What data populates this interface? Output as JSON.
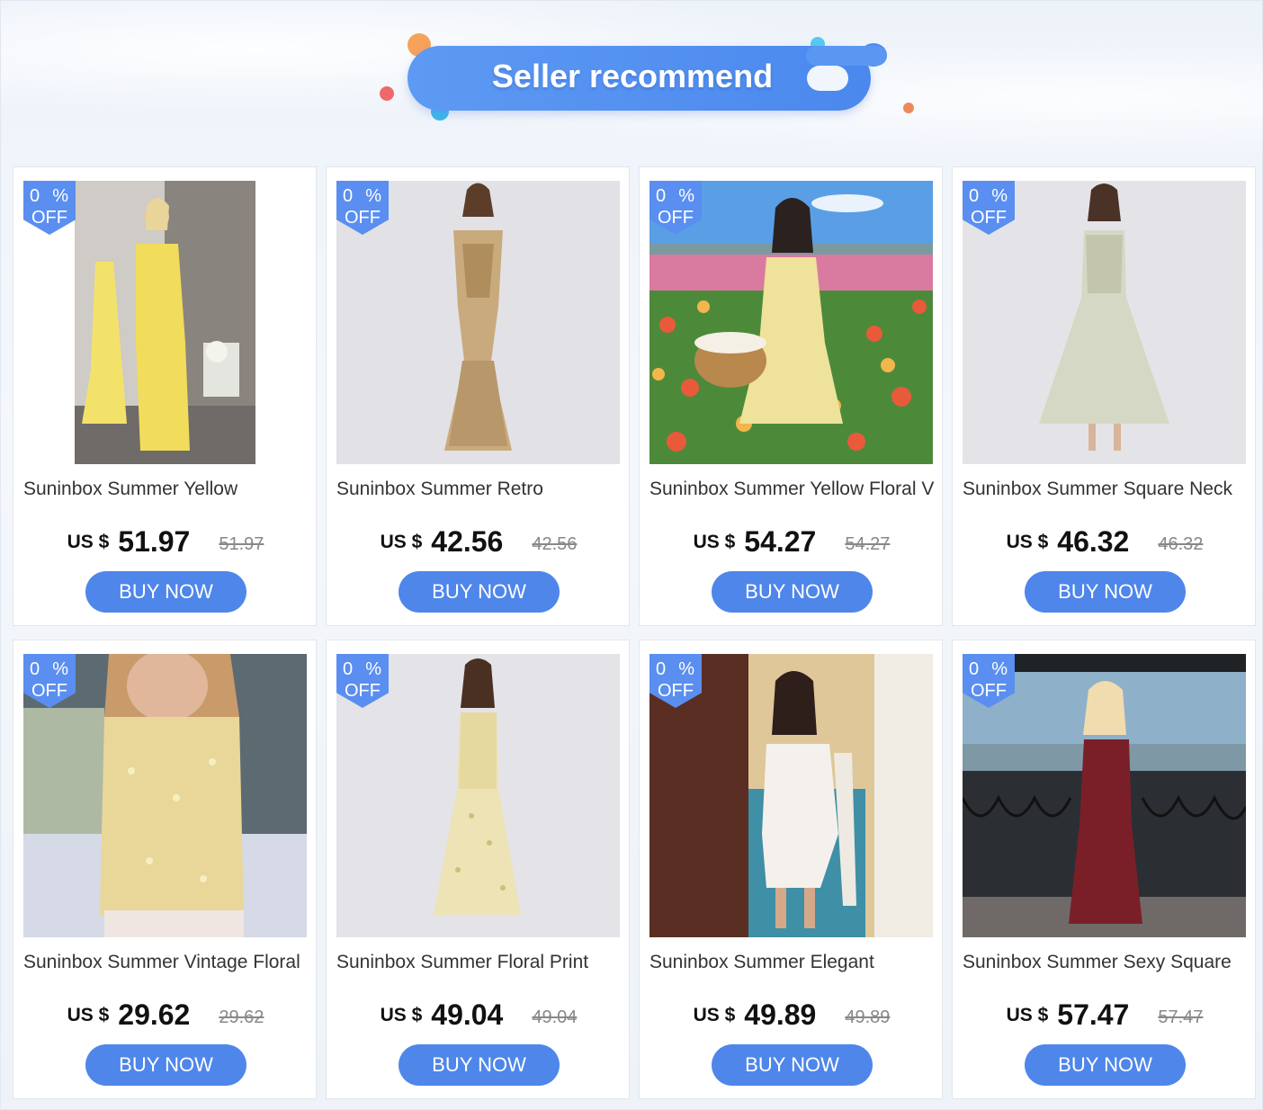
{
  "header": {
    "title": "Seller recommend",
    "pill_color": "#4b88ee"
  },
  "colors": {
    "badge": "#5a8ef0",
    "button": "#4f86ea"
  },
  "products": [
    {
      "title": "Suninbox Summer Yellow",
      "currency": "US $",
      "price": "51.97",
      "old_price": "51.97",
      "badge_pct": "0",
      "badge_sign": "%",
      "badge_off": "OFF",
      "button": "BUY NOW",
      "image": "yellow-strapless-gown-photo"
    },
    {
      "title": "Suninbox Summer Retro",
      "currency": "US $",
      "price": "42.56",
      "old_price": "42.56",
      "badge_pct": "0",
      "badge_sign": "%",
      "badge_off": "OFF",
      "button": "BUY NOW",
      "image": "lace-mermaid-dress-photo"
    },
    {
      "title": "Suninbox Summer Yellow Floral V",
      "currency": "US $",
      "price": "54.27",
      "old_price": "54.27",
      "badge_pct": "0",
      "badge_sign": "%",
      "badge_off": "OFF",
      "button": "BUY NOW",
      "image": "floral-mini-dress-flower-field-photo"
    },
    {
      "title": "Suninbox Summer Square Neck",
      "currency": "US $",
      "price": "46.32",
      "old_price": "46.32",
      "badge_pct": "0",
      "badge_sign": "%",
      "badge_off": "OFF",
      "button": "BUY NOW",
      "image": "square-neck-floral-midi-photo"
    },
    {
      "title": "Suninbox Summer Vintage Floral",
      "currency": "US $",
      "price": "29.62",
      "old_price": "29.62",
      "badge_pct": "0",
      "badge_sign": "%",
      "badge_off": "OFF",
      "button": "BUY NOW",
      "image": "vintage-floral-corset-top-photo"
    },
    {
      "title": "Suninbox Summer Floral Print",
      "currency": "US $",
      "price": "49.04",
      "old_price": "49.04",
      "badge_pct": "0",
      "badge_sign": "%",
      "badge_off": "OFF",
      "button": "BUY NOW",
      "image": "floral-print-maxi-photo"
    },
    {
      "title": "Suninbox Summer Elegant",
      "currency": "US $",
      "price": "49.89",
      "old_price": "49.89",
      "badge_pct": "0",
      "badge_sign": "%",
      "badge_off": "OFF",
      "button": "BUY NOW",
      "image": "white-elegant-mini-dress-photo"
    },
    {
      "title": "Suninbox Summer Sexy Square",
      "currency": "US $",
      "price": "57.47",
      "old_price": "57.47",
      "badge_pct": "0",
      "badge_sign": "%",
      "badge_off": "OFF",
      "button": "BUY NOW",
      "image": "burgundy-square-neck-maxi-photo"
    }
  ]
}
